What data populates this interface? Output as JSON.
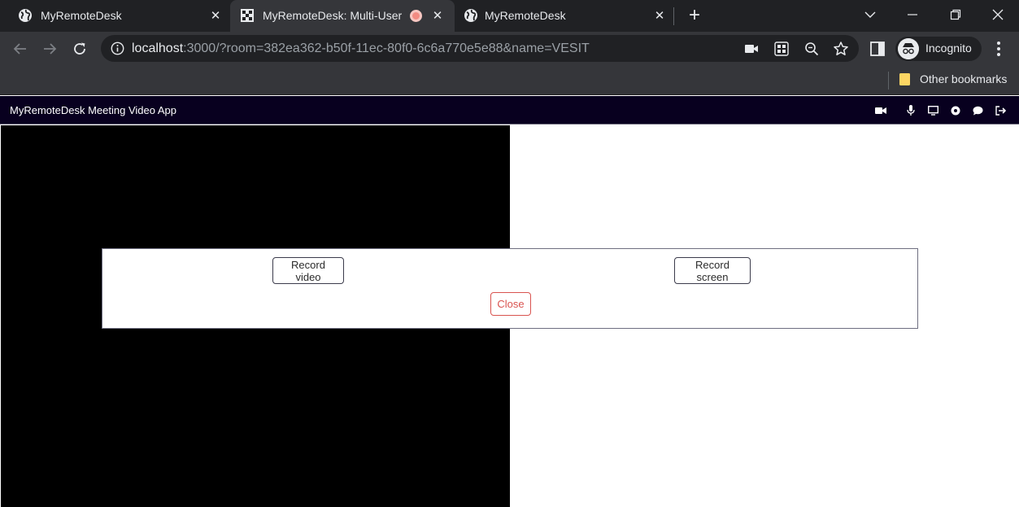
{
  "browser": {
    "tabs": [
      {
        "title": "MyRemoteDesk",
        "icon": "globe-icon",
        "active": false
      },
      {
        "title": "MyRemoteDesk: Multi-User Video",
        "icon": "app-favicon-icon",
        "active": true,
        "recording": true
      },
      {
        "title": "MyRemoteDesk",
        "icon": "globe-icon",
        "active": false
      }
    ],
    "address_bar": {
      "host": "localhost",
      "rest": ":3000/?room=382ea362-b50f-11ec-80f0-6c6a770e5e88&name=VESIT"
    },
    "profile_label": "Incognito",
    "bookmarks": [
      {
        "label": "Other bookmarks",
        "icon": "folder-icon"
      }
    ],
    "colors": {
      "tabstrip": "#202124",
      "toolbar": "#35363a",
      "recording": "#f28b82"
    }
  },
  "app": {
    "title": "MyRemoteDesk Meeting Video App",
    "header_icons": [
      "video-camera-icon",
      "microphone-icon",
      "screen-share-icon",
      "record-icon",
      "chat-icon",
      "leave-icon"
    ],
    "colors": {
      "header": "#08001f",
      "close_button": "#d9534f"
    }
  },
  "record_modal": {
    "record_video_label": "Record video",
    "record_screen_label": "Record screen",
    "close_label": "Close"
  }
}
